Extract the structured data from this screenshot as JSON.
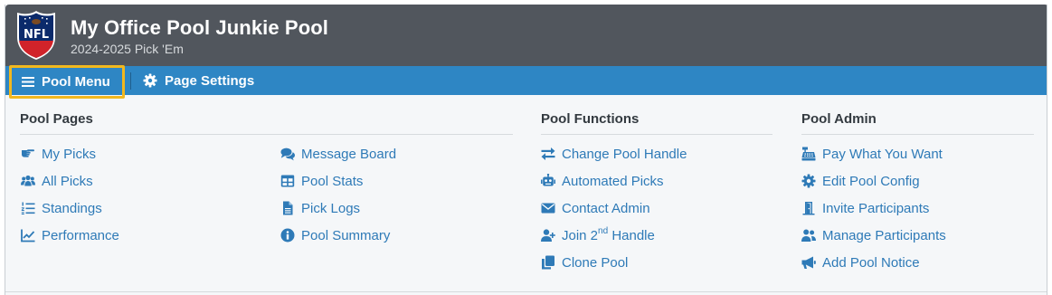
{
  "header": {
    "logo": "nfl-shield-logo",
    "logo_text": "NFL",
    "title": "My Office Pool Junkie Pool",
    "subtitle": "2024-2025 Pick 'Em"
  },
  "navbar": {
    "pool_menu": {
      "label": "Pool Menu",
      "icon": "hamburger-icon"
    },
    "page_settings": {
      "label": "Page Settings",
      "icon": "gear-icon"
    }
  },
  "colors": {
    "header_bg": "#51565d",
    "navbar_bg": "#2e86c4",
    "highlight": "#f2b81e",
    "link": "#2e7ab7"
  },
  "menu": {
    "pool_pages": {
      "heading": "Pool Pages",
      "col1": [
        {
          "label": "My Picks",
          "icon": "pointing-hand-icon"
        },
        {
          "label": "All Picks",
          "icon": "users-icon"
        },
        {
          "label": "Standings",
          "icon": "ordered-list-icon"
        },
        {
          "label": "Performance",
          "icon": "line-chart-icon"
        }
      ],
      "col2": [
        {
          "label": "Message Board",
          "icon": "comments-icon"
        },
        {
          "label": "Pool Stats",
          "icon": "table-icon"
        },
        {
          "label": "Pick Logs",
          "icon": "file-icon"
        },
        {
          "label": "Pool Summary",
          "icon": "info-circle-icon"
        }
      ]
    },
    "pool_functions": {
      "heading": "Pool Functions",
      "items": [
        {
          "label": "Change Pool Handle",
          "icon": "exchange-arrows-icon"
        },
        {
          "label": "Automated Picks",
          "icon": "robot-icon"
        },
        {
          "label": "Contact Admin",
          "icon": "envelope-icon"
        },
        {
          "label": "Join 2",
          "sup": "nd",
          "label_after": " Handle",
          "icon": "user-plus-icon"
        },
        {
          "label": "Clone Pool",
          "icon": "copy-icon"
        }
      ]
    },
    "pool_admin": {
      "heading": "Pool Admin",
      "items": [
        {
          "label": "Pay What You Want",
          "icon": "cash-register-icon"
        },
        {
          "label": "Edit Pool Config",
          "icon": "gear-icon"
        },
        {
          "label": "Invite Participants",
          "icon": "door-open-icon"
        },
        {
          "label": "Manage Participants",
          "icon": "users-icon"
        },
        {
          "label": "Add Pool Notice",
          "icon": "bullhorn-icon"
        }
      ]
    }
  }
}
